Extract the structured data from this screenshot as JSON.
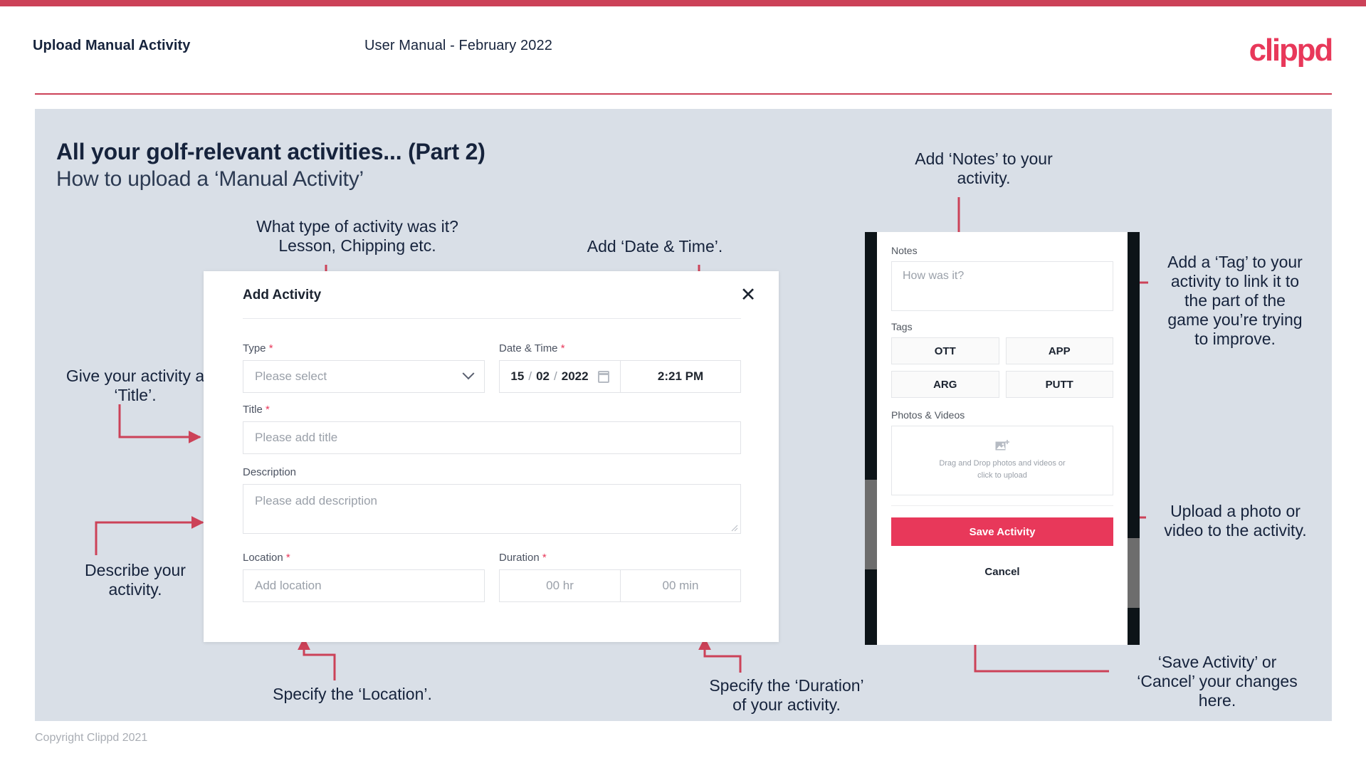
{
  "header": {
    "title": "Upload Manual Activity",
    "subtitle": "User Manual - February 2022",
    "logo": "clippd"
  },
  "slide": {
    "title": "All your golf-relevant activities... (Part 2)",
    "subtitle": "How to upload a ‘Manual Activity’"
  },
  "footer": {
    "copyright": "Copyright Clippd 2021"
  },
  "colors": {
    "accent": "#e8385a",
    "accent_rule": "#cc4258",
    "slide_bg": "#d9dfe7",
    "text_dark": "#16233c",
    "arrow": "#cc4258"
  },
  "dialog": {
    "title": "Add Activity",
    "close_icon": "close-icon",
    "type": {
      "label": "Type",
      "required": true,
      "placeholder": "Please select",
      "value": ""
    },
    "datetime": {
      "label": "Date & Time",
      "required": true,
      "day": "15",
      "month": "02",
      "year": "2022",
      "separator": "/",
      "time": "2:21 PM",
      "calendar_icon": "calendar-icon"
    },
    "title_field": {
      "label": "Title",
      "required": true,
      "placeholder": "Please add title",
      "value": ""
    },
    "description": {
      "label": "Description",
      "required": false,
      "placeholder": "Please add description",
      "value": ""
    },
    "location": {
      "label": "Location",
      "required": true,
      "placeholder": "Add location",
      "value": ""
    },
    "duration": {
      "label": "Duration",
      "required": true,
      "hours_placeholder": "00 hr",
      "minutes_placeholder": "00 min"
    }
  },
  "phone": {
    "notes": {
      "label": "Notes",
      "placeholder": "How was it?",
      "value": ""
    },
    "tags": {
      "label": "Tags",
      "items": [
        "OTT",
        "APP",
        "ARG",
        "PUTT"
      ]
    },
    "photos": {
      "label": "Photos & Videos",
      "icon": "add-image-icon",
      "line1": "Drag and Drop photos and videos or",
      "line2": "click to upload"
    },
    "save_label": "Save Activity",
    "cancel_label": "Cancel"
  },
  "annotations": {
    "type": "What type of activity was it?\nLesson, Chipping etc.",
    "datetime": "Add ‘Date & Time’.",
    "title": "Give your activity a\n‘Title’.",
    "description": "Describe your\nactivity.",
    "location": "Specify the ‘Location’.",
    "duration": "Specify the ‘Duration’\nof your activity.",
    "notes": "Add ‘Notes’ to your\nactivity.",
    "tags": "Add a ‘Tag’ to your\nactivity to link it to\nthe part of the\ngame you’re trying\nto improve.",
    "upload": "Upload a photo or\nvideo to the activity.",
    "save_cancel": "‘Save Activity’ or\n‘Cancel’ your changes\nhere."
  }
}
